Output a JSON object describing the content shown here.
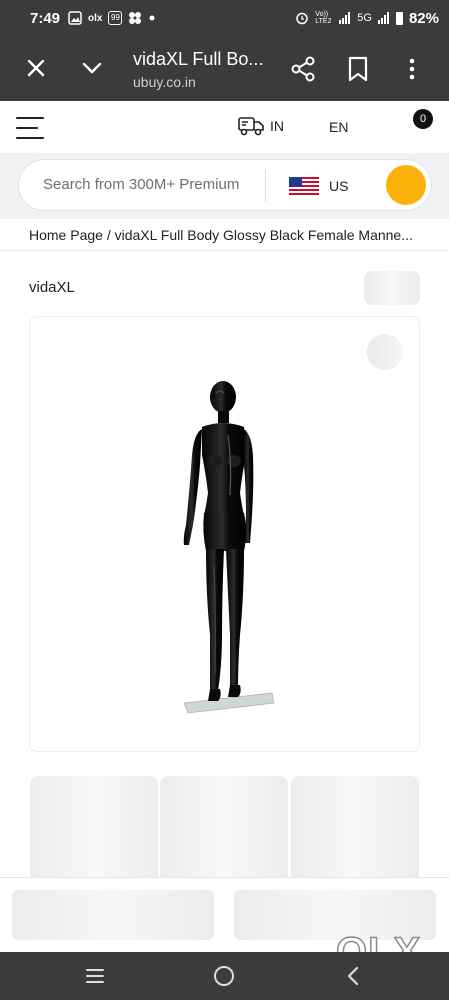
{
  "status_bar": {
    "time": "7:49",
    "left_icons": [
      "gallery-icon",
      "olx-notification-icon",
      "badge-99-icon",
      "pinwheel-icon",
      "dot-icon"
    ],
    "badge_text": "99",
    "olx_text": "olx",
    "network": "Vo)) LTE2",
    "signal_label": "5G",
    "battery": "82%"
  },
  "browser_tab": {
    "title": "vidaXL Full Bo...",
    "url": "ubuy.co.in"
  },
  "site_header": {
    "ship_to": "IN",
    "language": "EN",
    "cart_count": "0"
  },
  "search": {
    "placeholder": "Search from 300M+ Premium",
    "country": "US"
  },
  "breadcrumb": {
    "home": "Home Page",
    "separator": " / ",
    "current": "vidaXL Full Body Glossy Black Female Manne..."
  },
  "product": {
    "brand": "vidaXL"
  },
  "watermark": "OLX",
  "colors": {
    "browser_chrome": "#3a3b3d",
    "search_button": "#fdb10b",
    "text": "#222222"
  }
}
